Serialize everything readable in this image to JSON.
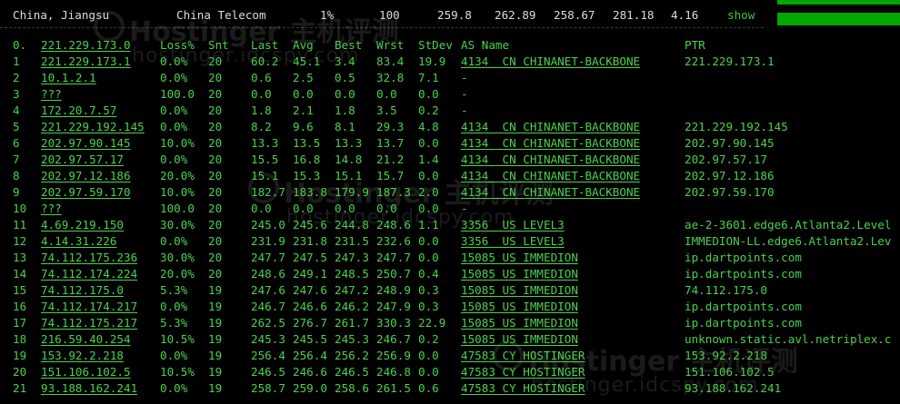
{
  "summary": {
    "location": "China, Jiangsu",
    "isp": "China Telecom",
    "loss": "1%",
    "sent": "100",
    "last": "259.8",
    "avg": "262.89",
    "best": "258.67",
    "worst": "281.18",
    "stdev": "4.16",
    "action": "show"
  },
  "watermark": {
    "brand": "Hostinger",
    "cn": "主机评测",
    "site": "hostinger.idcspy.com"
  },
  "table": {
    "headers": {
      "idx": "0.",
      "host": "221.229.173.0",
      "loss": "Loss%",
      "snt": "Snt",
      "last": "Last",
      "avg": "Avg",
      "best": "Best",
      "wrst": "Wrst",
      "stdev": "StDev",
      "as": "AS Name",
      "ptr": "PTR"
    },
    "rows": [
      {
        "idx": "1",
        "host": "221.229.173.1",
        "loss": "0.0%",
        "snt": "20",
        "last": "60.2",
        "avg": "45.1",
        "best": "3.4",
        "wrst": "83.4",
        "stdev": "19.9",
        "as": "4134  CN CHINANET-BACKBONE",
        "ptr": "221.229.173.1"
      },
      {
        "idx": "2",
        "host": "10.1.2.1",
        "loss": "0.0%",
        "snt": "20",
        "last": "0.6",
        "avg": "2.5",
        "best": "0.5",
        "wrst": "32.8",
        "stdev": "7.1",
        "as": "-",
        "ptr": ""
      },
      {
        "idx": "3",
        "host": "???",
        "loss": "100.0",
        "snt": "20",
        "last": "0.0",
        "avg": "0.0",
        "best": "0.0",
        "wrst": "0.0",
        "stdev": "0.0",
        "as": "-",
        "ptr": ""
      },
      {
        "idx": "4",
        "host": "172.20.7.57",
        "loss": "0.0%",
        "snt": "20",
        "last": "1.8",
        "avg": "2.1",
        "best": "1.8",
        "wrst": "3.5",
        "stdev": "0.2",
        "as": "-",
        "ptr": ""
      },
      {
        "idx": "5",
        "host": "221.229.192.145",
        "loss": "0.0%",
        "snt": "20",
        "last": "8.2",
        "avg": "9.6",
        "best": "8.1",
        "wrst": "29.3",
        "stdev": "4.8",
        "as": "4134  CN CHINANET-BACKBONE",
        "ptr": "221.229.192.145"
      },
      {
        "idx": "6",
        "host": "202.97.90.145",
        "loss": "10.0%",
        "snt": "20",
        "last": "13.3",
        "avg": "13.5",
        "best": "13.3",
        "wrst": "13.7",
        "stdev": "0.0",
        "as": "4134  CN CHINANET-BACKBONE",
        "ptr": "202.97.90.145"
      },
      {
        "idx": "7",
        "host": "202.97.57.17",
        "loss": "0.0%",
        "snt": "20",
        "last": "15.5",
        "avg": "16.8",
        "best": "14.8",
        "wrst": "21.2",
        "stdev": "1.4",
        "as": "4134  CN CHINANET-BACKBONE",
        "ptr": "202.97.57.17"
      },
      {
        "idx": "8",
        "host": "202.97.12.186",
        "loss": "20.0%",
        "snt": "20",
        "last": "15.1",
        "avg": "15.3",
        "best": "15.1",
        "wrst": "15.7",
        "stdev": "0.0",
        "as": "4134  CN CHINANET-BACKBONE",
        "ptr": "202.97.12.186"
      },
      {
        "idx": "9",
        "host": "202.97.59.170",
        "loss": "10.0%",
        "snt": "20",
        "last": "182.7",
        "avg": "183.8",
        "best": "179.9",
        "wrst": "187.3",
        "stdev": "2.0",
        "as": "4134  CN CHINANET-BACKBONE",
        "ptr": "202.97.59.170"
      },
      {
        "idx": "10",
        "host": "???",
        "loss": "100.0",
        "snt": "20",
        "last": "0.0",
        "avg": "0.0",
        "best": "0.0",
        "wrst": "0.0",
        "stdev": "0.0",
        "as": "-",
        "ptr": ""
      },
      {
        "idx": "11",
        "host": "4.69.219.150",
        "loss": "30.0%",
        "snt": "20",
        "last": "245.0",
        "avg": "245.6",
        "best": "244.8",
        "wrst": "248.6",
        "stdev": "1.1",
        "as": "3356  US LEVEL3",
        "ptr": "ae-2-3601.edge6.Atlanta2.Level"
      },
      {
        "idx": "12",
        "host": "4.14.31.226",
        "loss": "0.0%",
        "snt": "20",
        "last": "231.9",
        "avg": "231.8",
        "best": "231.5",
        "wrst": "232.6",
        "stdev": "0.0",
        "as": "3356  US LEVEL3",
        "ptr": "IMMEDION-LL.edge6.Atlanta2.Lev"
      },
      {
        "idx": "13",
        "host": "74.112.175.236",
        "loss": "30.0%",
        "snt": "20",
        "last": "247.7",
        "avg": "247.5",
        "best": "247.3",
        "wrst": "247.7",
        "stdev": "0.0",
        "as": "15085 US IMMEDION",
        "ptr": "ip.dartpoints.com"
      },
      {
        "idx": "14",
        "host": "74.112.174.224",
        "loss": "20.0%",
        "snt": "20",
        "last": "248.6",
        "avg": "249.1",
        "best": "248.5",
        "wrst": "250.7",
        "stdev": "0.4",
        "as": "15085 US IMMEDION",
        "ptr": "ip.dartpoints.com"
      },
      {
        "idx": "15",
        "host": "74.112.175.0",
        "loss": "5.3%",
        "snt": "19",
        "last": "247.6",
        "avg": "247.6",
        "best": "247.2",
        "wrst": "248.9",
        "stdev": "0.3",
        "as": "15085 US IMMEDION",
        "ptr": "74.112.175.0"
      },
      {
        "idx": "16",
        "host": "74.112.174.217",
        "loss": "0.0%",
        "snt": "19",
        "last": "246.7",
        "avg": "246.6",
        "best": "246.2",
        "wrst": "247.9",
        "stdev": "0.3",
        "as": "15085 US IMMEDION",
        "ptr": "ip.dartpoints.com"
      },
      {
        "idx": "17",
        "host": "74.112.175.217",
        "loss": "5.3%",
        "snt": "19",
        "last": "262.5",
        "avg": "276.7",
        "best": "261.7",
        "wrst": "330.3",
        "stdev": "22.9",
        "as": "15085 US IMMEDION",
        "ptr": "ip.dartpoints.com"
      },
      {
        "idx": "18",
        "host": "216.59.40.254",
        "loss": "10.5%",
        "snt": "19",
        "last": "245.3",
        "avg": "245.5",
        "best": "245.3",
        "wrst": "246.7",
        "stdev": "0.2",
        "as": "15085 US IMMEDION",
        "ptr": "unknown.static.avl.netriplex.c"
      },
      {
        "idx": "19",
        "host": "153.92.2.218",
        "loss": "0.0%",
        "snt": "19",
        "last": "256.4",
        "avg": "256.4",
        "best": "256.2",
        "wrst": "256.9",
        "stdev": "0.0",
        "as": "47583 CY HOSTINGER",
        "ptr": "153.92.2.218"
      },
      {
        "idx": "20",
        "host": "151.106.102.5",
        "loss": "10.5%",
        "snt": "19",
        "last": "246.5",
        "avg": "246.6",
        "best": "246.5",
        "wrst": "246.8",
        "stdev": "0.0",
        "as": "47583 CY HOSTINGER",
        "ptr": "151.106.102.5"
      },
      {
        "idx": "21",
        "host": "93.188.162.241",
        "loss": "0.0%",
        "snt": "19",
        "last": "258.7",
        "avg": "259.0",
        "best": "258.6",
        "wrst": "261.5",
        "stdev": "0.6",
        "as": "47583 CY HOSTINGER",
        "ptr": "93.188.162.241"
      }
    ]
  }
}
